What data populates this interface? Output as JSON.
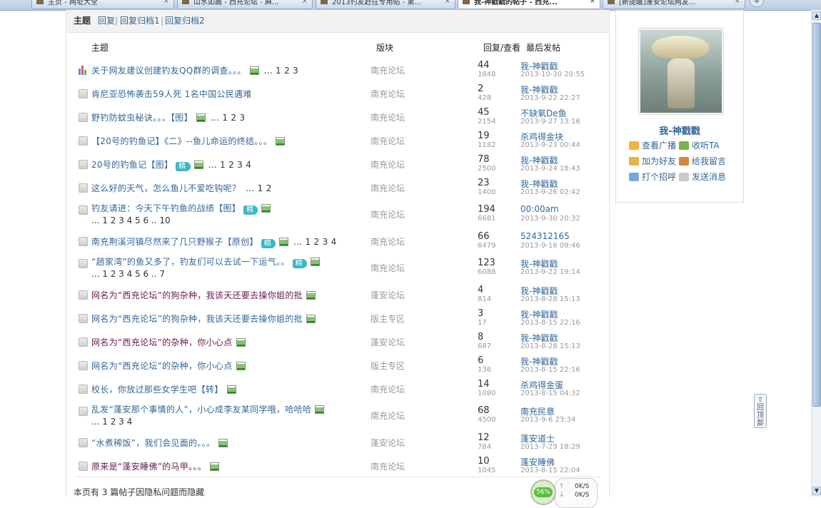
{
  "browser_tabs": [
    {
      "label": "主页 - 网址大全"
    },
    {
      "label": "山水如画 - 西充论坛 - 麻..."
    },
    {
      "label": "2013钓友赶往专用帖 - 第..."
    },
    {
      "label": "我-神戳戳的帖子 - 西充...",
      "active": true
    },
    {
      "label": "[新提醒]蓬安论坛网友..."
    }
  ],
  "subnav": {
    "items": [
      "主题",
      "回复",
      "回复归档1",
      "回复归档2"
    ],
    "separator": "|"
  },
  "table_header": {
    "title": "主题",
    "forum": "版块",
    "reply_view": "回复/查看",
    "last_post": "最后发帖"
  },
  "rows": [
    {
      "icon": "poll",
      "title": "关于网友建议创建钓友QQ群的调查。。。",
      "img": true,
      "jing": false,
      "pages": "... 1 2 3",
      "forum": "南充论坛",
      "replies": "44",
      "views": "1848",
      "last_user": "我-神戳戳",
      "last_time": "2013-10-30 20:55"
    },
    {
      "icon": "doc",
      "title": "肯尼亚恐怖袭击59人死 1名中国公民遇难",
      "img": false,
      "jing": false,
      "pages": "",
      "forum": "南充论坛",
      "replies": "2",
      "views": "428",
      "last_user": "我-神戳戳",
      "last_time": "2013-9-22 22:27"
    },
    {
      "icon": "doc",
      "title": "野钓防蚊虫秘诀。。。【图】",
      "img": true,
      "jing": false,
      "pages": "... 1 2 3",
      "forum": "南充论坛",
      "replies": "45",
      "views": "2154",
      "last_user": "不缺氧De鱼",
      "last_time": "2013-9-27 13:16"
    },
    {
      "icon": "doc",
      "title": "【20号的钓鱼记】《二》--鱼儿命运的终结。。。",
      "img": true,
      "jing": false,
      "pages": "",
      "forum": "南充论坛",
      "replies": "19",
      "views": "1182",
      "last_user": "杀鸡得金块",
      "last_time": "2013-9-23 00:44"
    },
    {
      "icon": "doc",
      "title": "20号的钓鱼记【图】",
      "img": true,
      "jing": true,
      "pages": "... 1 2 3 4",
      "forum": "南充论坛",
      "replies": "78",
      "views": "2500",
      "last_user": "我-神戳戳",
      "last_time": "2013-9-24 18:43"
    },
    {
      "icon": "doc",
      "title": "这么好的天气，怎么鱼儿不爱吃钩呢？",
      "img": false,
      "jing": false,
      "pages": "... 1 2",
      "forum": "南充论坛",
      "replies": "23",
      "views": "1400",
      "last_user": "我-神戳戳",
      "last_time": "2013-9-26 02:42"
    },
    {
      "icon": "doc",
      "title": "钓友请进：今天下午钓鱼的战绩【图】",
      "img": true,
      "jing": true,
      "pages": "",
      "pages2": "... 1 2 3 4 5 6 .. 10",
      "forum": "南充论坛",
      "replies": "194",
      "views": "6681",
      "last_user": "00:00am",
      "last_time": "2013-9-30 20:32"
    },
    {
      "icon": "doc",
      "title": "南充荆溪河镇尽然来了几只野猴子【原创】",
      "img": true,
      "jing": true,
      "pages": "... 1 2 3 4",
      "forum": "南充论坛",
      "replies": "66",
      "views": "6479",
      "last_user": "524312165",
      "last_time": "2013-9-16 09:46"
    },
    {
      "icon": "doc",
      "title": "“趙家湾”的鱼又多了，钓友们可以去试一下运气。。",
      "img": true,
      "jing": true,
      "pages": "",
      "pages2": "... 1 2 3 4 5 6 .. 7",
      "forum": "南充论坛",
      "replies": "123",
      "views": "6088",
      "last_user": "我-神戳戳",
      "last_time": "2013-9-22 19:14"
    },
    {
      "icon": "doc",
      "title": "网名为“西充论坛”的狗杂种，我该天还要去操你姐的批",
      "img": true,
      "jing": false,
      "visited": true,
      "pages": "",
      "forum": "蓬安论坛",
      "replies": "4",
      "views": "814",
      "last_user": "我-神戳戳",
      "last_time": "2013-8-28 15:13"
    },
    {
      "icon": "doc",
      "title": "网名为“西充论坛”的狗杂种，我该天还要去操你姐的批",
      "img": true,
      "jing": false,
      "pages": "",
      "forum": "版主专区",
      "replies": "3",
      "views": "17",
      "last_user": "我-神戳戳",
      "last_time": "2013-8-15 22:16"
    },
    {
      "icon": "doc",
      "title": "网名为“西充论坛”的杂种，你小心点",
      "img": true,
      "jing": false,
      "visited": true,
      "pages": "",
      "forum": "蓬安论坛",
      "replies": "8",
      "views": "687",
      "last_user": "我-神戳戳",
      "last_time": "2013-8-28 15:13"
    },
    {
      "icon": "doc",
      "title": "网名为“西充论坛”的杂种，你小心点",
      "img": true,
      "jing": false,
      "pages": "",
      "forum": "版主专区",
      "replies": "6",
      "views": "136",
      "last_user": "我-神戳戳",
      "last_time": "2013-8-15 22:16"
    },
    {
      "icon": "doc",
      "title": "校长，你放过那些女学生吧【转】",
      "img": true,
      "jing": false,
      "pages": "",
      "forum": "南充论坛",
      "replies": "14",
      "views": "1080",
      "last_user": "杀鸡得金蛋",
      "last_time": "2013-8-15 04:32"
    },
    {
      "icon": "doc",
      "title": "乱发“蓬安那个事情的人”，小心成李友某同学哦，哈哈哈",
      "img": true,
      "jing": false,
      "pages": "",
      "pages2": "... 1 2 3 4",
      "forum": "南充论坛",
      "replies": "68",
      "views": "4500",
      "last_user": "南充民意",
      "last_time": "2013-9-6 23:34"
    },
    {
      "icon": "doc",
      "title": "“水煮稀饭”，我们会见面的。。。",
      "img": true,
      "jing": false,
      "pages": "",
      "forum": "蓬安论坛",
      "replies": "12",
      "views": "784",
      "last_user": "蓬安道士",
      "last_time": "2013-7-29 18:29"
    },
    {
      "icon": "doc",
      "title": "原来是“蓬安睡佛”的马甲。。。",
      "img": true,
      "jing": false,
      "visited": true,
      "pages": "",
      "forum": "南充论坛",
      "replies": "10",
      "views": "1045",
      "last_user": "蓬安睡佛",
      "last_time": "2013-8-15 22:04"
    }
  ],
  "footer_note": "本页有 3 篇帖子因隐私问题而隐藏",
  "speed_widget": {
    "percent": "56%",
    "up": "0K/S",
    "down": "0K/S"
  },
  "profile": {
    "name": "我-神戳戳",
    "actions": [
      "查看广播",
      "收听TA",
      "加为好友",
      "给我留言",
      "打个招呼",
      "发送消息"
    ]
  },
  "back_to_top": "回顶部",
  "colors": {
    "link": "#336699",
    "visited": "#6a1a4a",
    "muted": "#999999",
    "jing_badge": "#3cb6c8"
  }
}
